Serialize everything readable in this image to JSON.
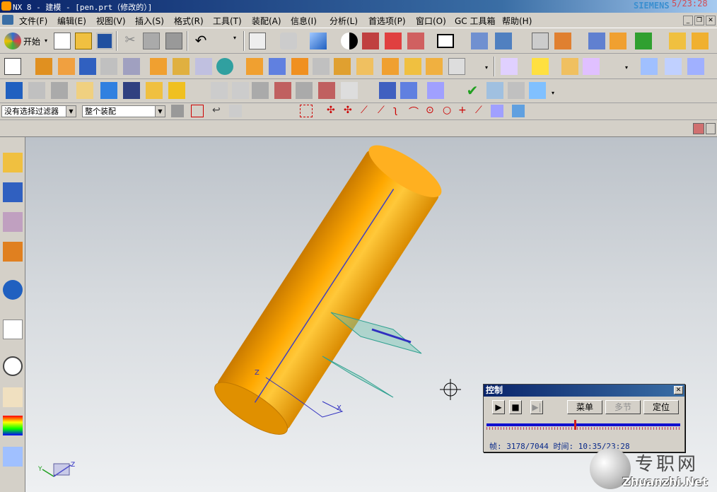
{
  "window": {
    "title": "NX 8 - 建模 - [pen.prt（修改的）]",
    "brand": "SIEMENS",
    "overlay_time": "5/23:28"
  },
  "menu": [
    "文件(F)",
    "编辑(E)",
    "视图(V)",
    "插入(S)",
    "格式(R)",
    "工具(T)",
    "装配(A)",
    "信息(I)",
    "分析(L)",
    "首选项(P)",
    "窗口(O)",
    "GC 工具箱",
    "帮助(H)"
  ],
  "toolbar": {
    "start_label": "开始"
  },
  "selection": {
    "filter": "没有选择过滤器",
    "scope": "整个装配"
  },
  "viewport": {
    "axis_z": "Z",
    "axis_x": "X",
    "triad_y": "Y",
    "triad_z": "Z"
  },
  "control_panel": {
    "title": "控制",
    "menu_button": "菜单",
    "multi_button": "多节",
    "locate_button": "定位",
    "status": "帧: 3178/7044 时间: 10:35/23:28",
    "progress_fraction": 0.451
  },
  "watermark": {
    "cn": "专职网",
    "en": "Zhuanzhi.Net"
  },
  "colors": {
    "accent": "#ffa500",
    "title_blue": "#0a246a",
    "track": "#1010d0"
  }
}
